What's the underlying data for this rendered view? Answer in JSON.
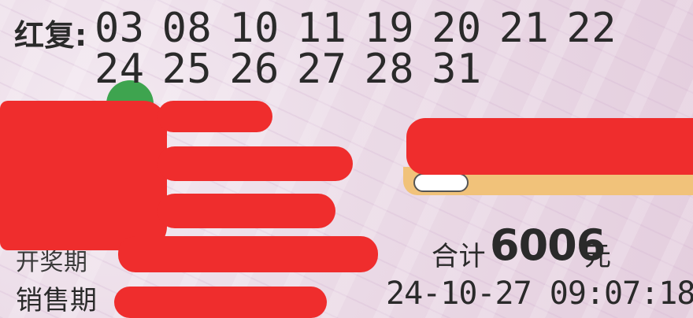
{
  "ticket": {
    "red_label": "红复:",
    "numbers_row1": [
      "03",
      "08",
      "10",
      "11",
      "19",
      "20",
      "21",
      "22"
    ],
    "numbers_row2": [
      "24",
      "25",
      "26",
      "27",
      "28",
      "31"
    ],
    "open_label": "开奖期",
    "sale_label": "销售期",
    "total_label": "合计",
    "total_amount": "6006",
    "total_unit": "元",
    "datetime": "24-10-27 09:07:18"
  },
  "colors": {
    "redaction": "#ef2d2d",
    "paper": "#ebdbe7",
    "text": "#2a2a2a",
    "accent_orange": "#f1c27a"
  }
}
